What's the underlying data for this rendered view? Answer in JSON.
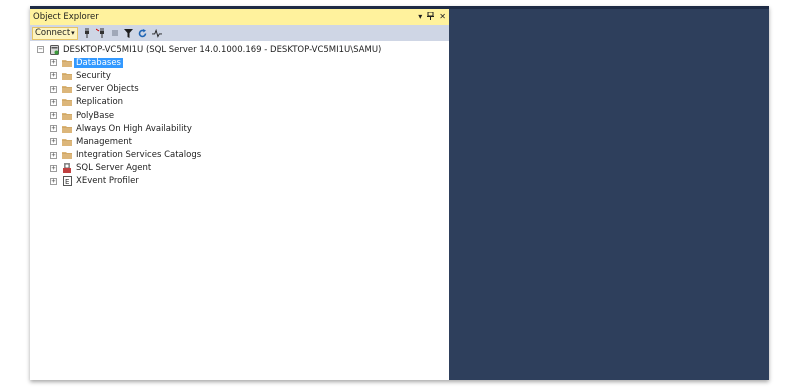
{
  "panel": {
    "title": "Object Explorer",
    "pin_glyph": "▾",
    "dock_glyph": "ᛘ",
    "close_glyph": "✕"
  },
  "toolbar": {
    "connect_label": "Connect",
    "connect_caret": "▾"
  },
  "tree": {
    "root": {
      "label": "DESKTOP-VC5MI1U (SQL Server 14.0.1000.169 - DESKTOP-VC5MI1U\\SAMU)",
      "expander": "⊟"
    },
    "items": [
      {
        "label": "Databases",
        "icon": "folder-icon",
        "selected": true
      },
      {
        "label": "Security",
        "icon": "folder-icon"
      },
      {
        "label": "Server Objects",
        "icon": "folder-icon"
      },
      {
        "label": "Replication",
        "icon": "folder-icon"
      },
      {
        "label": "PolyBase",
        "icon": "folder-icon"
      },
      {
        "label": "Always On High Availability",
        "icon": "folder-icon"
      },
      {
        "label": "Management",
        "icon": "folder-icon"
      },
      {
        "label": "Integration Services Catalogs",
        "icon": "folder-icon"
      },
      {
        "label": "SQL Server Agent",
        "icon": "sql-agent-icon"
      },
      {
        "label": "XEvent Profiler",
        "icon": "xevent-profiler-icon"
      }
    ],
    "expander_glyph": "+"
  },
  "colors": {
    "header_bg": "#fff29d",
    "toolbar_bg": "#cfd6e5",
    "selection": "#3399ff",
    "folder": "#dcb67a",
    "workspace": "#2e3f5c"
  }
}
